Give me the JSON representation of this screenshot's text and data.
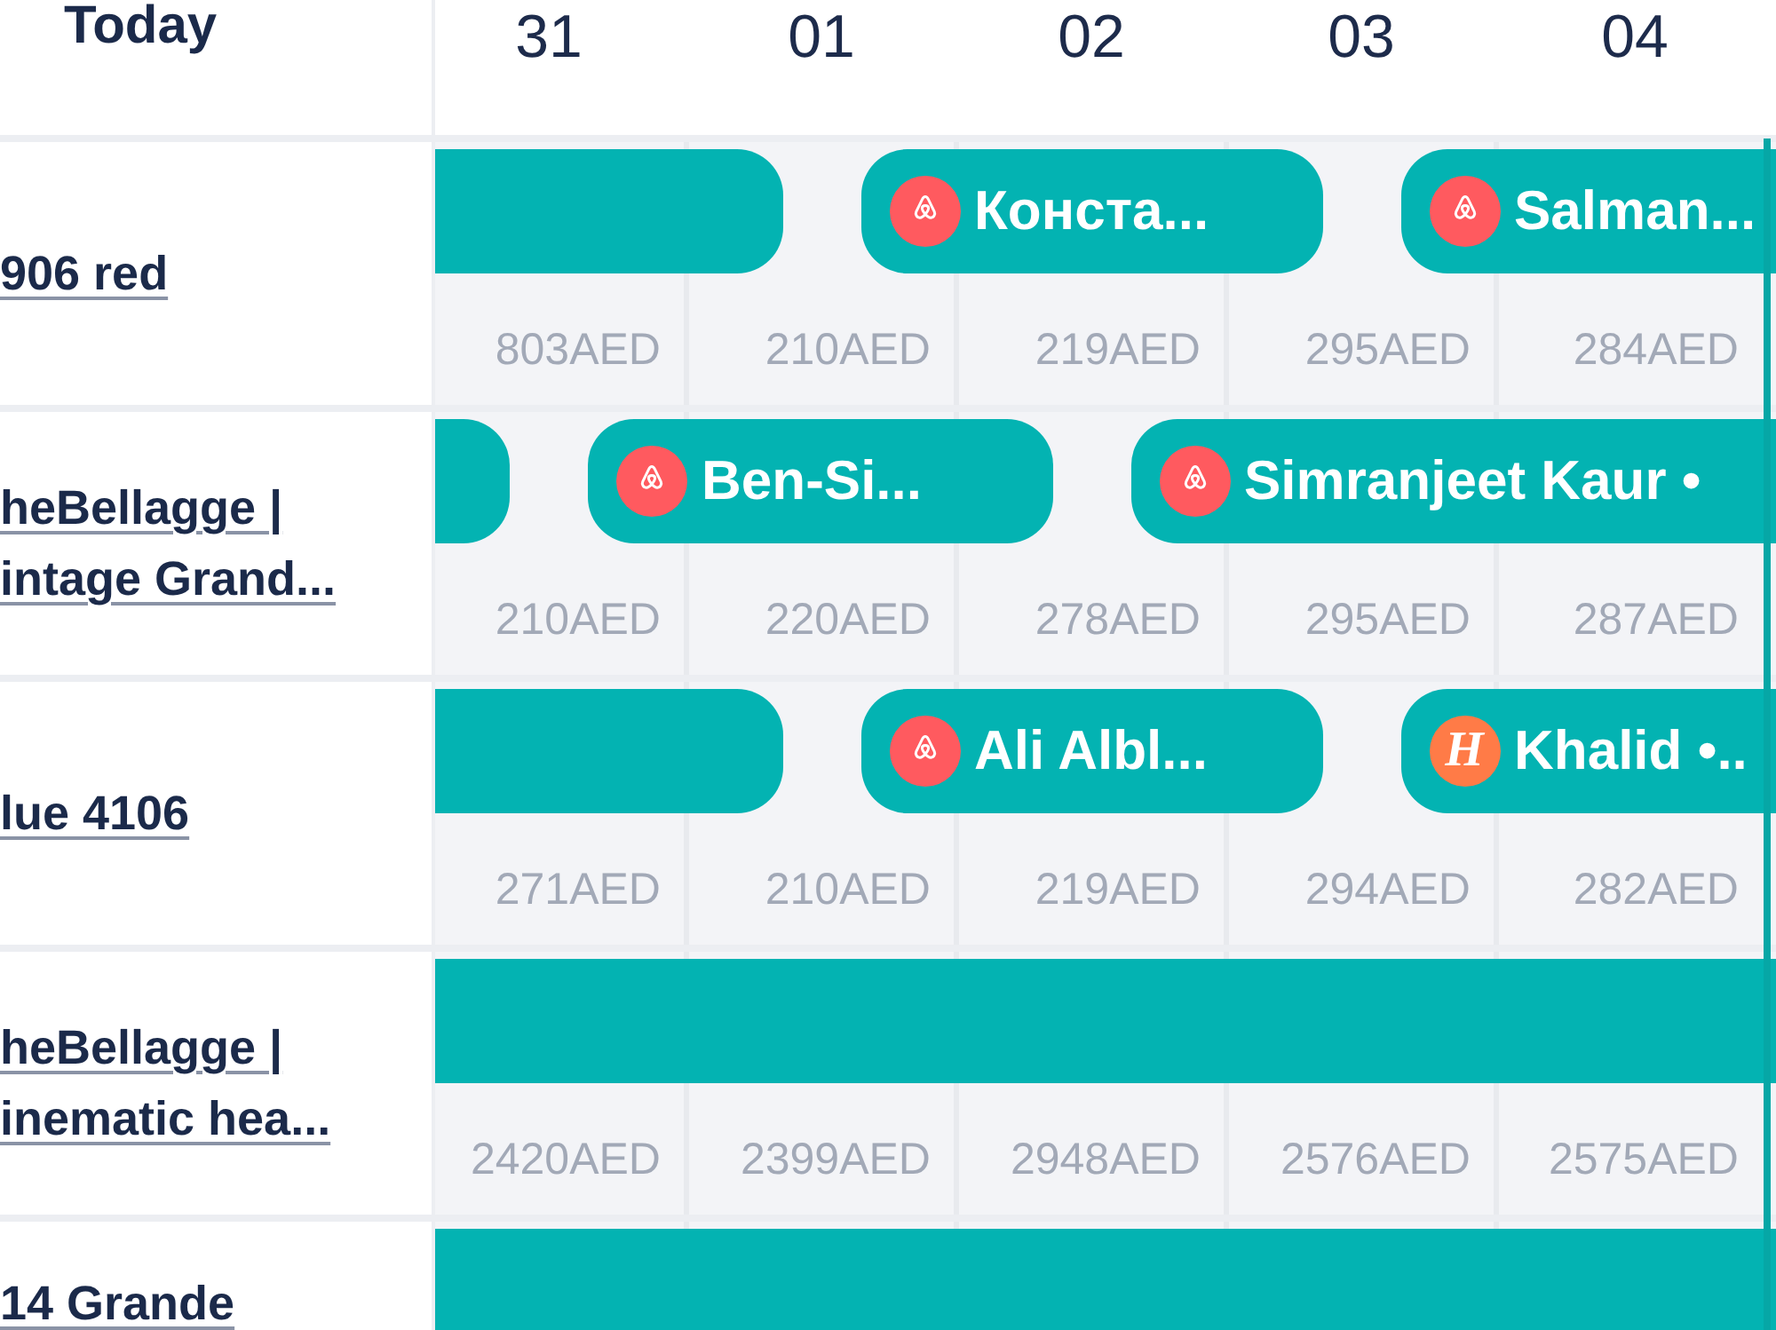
{
  "header": {
    "today_label": "Today",
    "dates": [
      "31",
      "01",
      "02",
      "03",
      "04"
    ]
  },
  "listings": [
    {
      "name": "906 red",
      "stays": [
        {
          "from_earlier": true,
          "continues": false,
          "nights": [
            {
              "price": "803AED"
            }
          ]
        },
        {
          "guest": "Конста...",
          "channel": {
            "kind": "airbnb"
          },
          "from_earlier": false,
          "continues": false,
          "nights": [
            {
              "price": "210AED"
            },
            {
              "price": "219AED"
            }
          ]
        },
        {
          "guest": "Salman...",
          "channel": {
            "kind": "airbnb"
          },
          "from_earlier": false,
          "continues": true,
          "nights": [
            {
              "price": "295AED"
            },
            {
              "price": "284AED"
            }
          ]
        }
      ]
    },
    {
      "name": "heBellagge | intage Grand...",
      "stays": [
        {
          "from_earlier": true,
          "continues": false
        },
        {
          "guest": "Ben-Si...",
          "channel": {
            "kind": "airbnb"
          },
          "from_earlier": false,
          "continues": false,
          "nights": [
            {
              "price": "210AED"
            },
            {
              "price": "220AED"
            }
          ]
        },
        {
          "guest": "Simranjeet Kaur •",
          "channel": {
            "kind": "airbnb"
          },
          "from_earlier": false,
          "continues": true,
          "nights": [
            {
              "price": "278AED"
            },
            {
              "price": "295AED"
            },
            {
              "price": "287AED"
            }
          ]
        }
      ]
    },
    {
      "name": "lue 4106",
      "stays": [
        {
          "from_earlier": true,
          "continues": false,
          "nights": [
            {
              "price": "271AED"
            }
          ]
        },
        {
          "guest": "Ali Albl...",
          "channel": {
            "kind": "airbnb"
          },
          "from_earlier": false,
          "continues": false,
          "nights": [
            {
              "price": "210AED"
            },
            {
              "price": "219AED"
            }
          ]
        },
        {
          "guest": "Khalid •..",
          "channel": {
            "kind": "monogram",
            "letter": "H"
          },
          "from_earlier": false,
          "continues": true,
          "nights": [
            {
              "price": "294AED"
            },
            {
              "price": "282AED"
            }
          ]
        }
      ]
    },
    {
      "name": "heBellagge | inematic hea...",
      "stays": [
        {
          "from_earlier": true,
          "continues": true,
          "nights": [
            {
              "price": "2420AED"
            },
            {
              "price": "2399AED"
            },
            {
              "price": "2948AED"
            },
            {
              "price": "2576AED"
            },
            {
              "price": "2575AED"
            }
          ]
        }
      ]
    },
    {
      "name": "14 Grande",
      "stays": [
        {
          "from_earlier": true,
          "continues": true
        }
      ]
    }
  ]
}
